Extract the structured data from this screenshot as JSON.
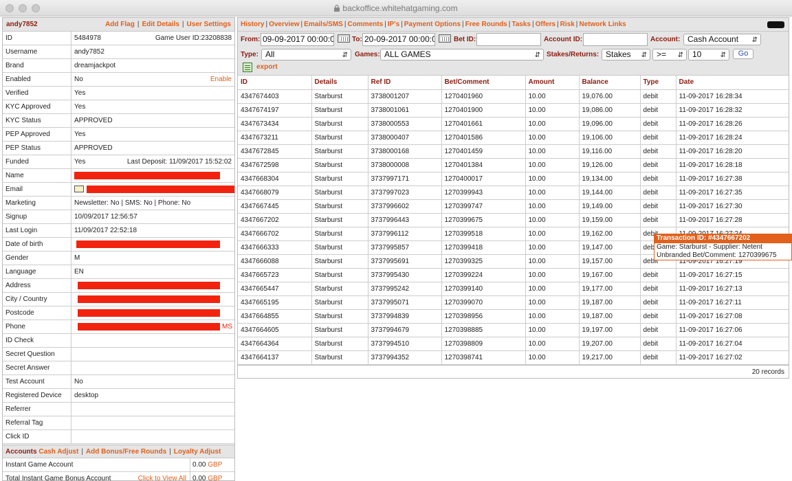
{
  "browser": {
    "url": "backoffice.whitehatgaming.com"
  },
  "player": {
    "username_title": "andy7852",
    "header_links": [
      "Add Flag",
      "Edit Details",
      "User Settings"
    ],
    "rows": [
      {
        "label": "ID",
        "value": "5484978",
        "extra": "Game User ID:23208838"
      },
      {
        "label": "Username",
        "value": "andy7852"
      },
      {
        "label": "Brand",
        "value": "dreamjackpot"
      },
      {
        "label": "Enabled",
        "value": "No",
        "extra_link": "Enable"
      },
      {
        "label": "Verified",
        "value": "Yes"
      },
      {
        "label": "KYC Approved",
        "value": "Yes"
      },
      {
        "label": "KYC Status",
        "value": "APPROVED"
      },
      {
        "label": "PEP Approved",
        "value": "Yes"
      },
      {
        "label": "PEP Status",
        "value": "APPROVED"
      },
      {
        "label": "Funded",
        "value": "Yes",
        "extra": "Last Deposit: 11/09/2017 15:52:02"
      },
      {
        "label": "Name",
        "redacted": true
      },
      {
        "label": "Email",
        "redacted": true,
        "icon": "email-icon"
      },
      {
        "label": "Marketing",
        "value": "Newsletter: No  |  SMS: No  |  Phone: No"
      },
      {
        "label": "Signup",
        "value": "10/09/2017 12:56:57"
      },
      {
        "label": "Last Login",
        "value": "11/09/2017 22:52:18"
      },
      {
        "label": "Date of birth",
        "redacted": true
      },
      {
        "label": "Gender",
        "value": "M"
      },
      {
        "label": "Language",
        "value": "EN"
      },
      {
        "label": "Address",
        "redacted": true
      },
      {
        "label": "City / Country",
        "redacted": true
      },
      {
        "label": "Postcode",
        "redacted": true
      },
      {
        "label": "Phone",
        "redacted": true,
        "suffix": "MS"
      },
      {
        "label": "ID Check",
        "value": ""
      },
      {
        "label": "Secret Question",
        "value": ""
      },
      {
        "label": "Secret Answer",
        "value": ""
      },
      {
        "label": "Test Account",
        "value": "No"
      },
      {
        "label": "Registered Device",
        "value": "desktop"
      },
      {
        "label": "Referrer",
        "value": ""
      },
      {
        "label": "Referral Tag",
        "value": ""
      },
      {
        "label": "Click ID",
        "value": ""
      }
    ],
    "accounts": {
      "title": "Accounts",
      "links": [
        "Cash Adjust",
        "Add Bonus/Free Rounds",
        "Loyalty Adjust"
      ],
      "rows": [
        {
          "label": "Instant Game Account",
          "value": "0.00",
          "currency": "GBP"
        },
        {
          "label": "Total Instant Game Bonus Account",
          "link": "Click to View All",
          "value": "0.00",
          "currency": "GBP"
        }
      ]
    }
  },
  "nav": {
    "tabs": [
      "History",
      "Overview",
      "Emails/SMS",
      "Comments",
      "IP's",
      "Payment Options",
      "Free Rounds",
      "Tasks",
      "Offers",
      "Risk",
      "Network Links"
    ]
  },
  "filters": {
    "from_label": "From:",
    "from_value": "09-09-2017 00:00:00",
    "to_label": "To:",
    "to_value": "20-09-2017 00:00:00",
    "betid_label": "Bet ID:",
    "betid_value": "",
    "accountid_label": "Account ID:",
    "accountid_value": "",
    "account_label": "Account:",
    "account_value": "Cash Account",
    "type_label": "Type:",
    "type_value": "All",
    "games_label": "Games:",
    "games_value": "ALL GAMES",
    "stakes_label": "Stakes/Returns:",
    "stakes_value": "Stakes",
    "op_value": ">=",
    "amount_value": "10",
    "go_label": "Go",
    "export_label": "export"
  },
  "table": {
    "columns": [
      "ID",
      "Details",
      "Ref ID",
      "Bet/Comment",
      "Amount",
      "Balance",
      "Type",
      "Date"
    ],
    "rows": [
      [
        "4347674403",
        "Starburst",
        "3738001207",
        "1270401960",
        "10.00",
        "19,076.00",
        "debit",
        "11-09-2017 16:28:34"
      ],
      [
        "4347674197",
        "Starburst",
        "3738001061",
        "1270401900",
        "10.00",
        "19,086.00",
        "debit",
        "11-09-2017 16:28:32"
      ],
      [
        "4347673434",
        "Starburst",
        "3738000553",
        "1270401661",
        "10.00",
        "19,096.00",
        "debit",
        "11-09-2017 16:28:26"
      ],
      [
        "4347673211",
        "Starburst",
        "3738000407",
        "1270401586",
        "10.00",
        "19,106.00",
        "debit",
        "11-09-2017 16:28:24"
      ],
      [
        "4347672845",
        "Starburst",
        "3738000168",
        "1270401459",
        "10.00",
        "19,116.00",
        "debit",
        "11-09-2017 16:28:20"
      ],
      [
        "4347672598",
        "Starburst",
        "3738000008",
        "1270401384",
        "10.00",
        "19,126.00",
        "debit",
        "11-09-2017 16:28:18"
      ],
      [
        "4347668304",
        "Starburst",
        "3737997171",
        "1270400017",
        "10.00",
        "19,134.00",
        "debit",
        "11-09-2017 16:27:38"
      ],
      [
        "4347668079",
        "Starburst",
        "3737997023",
        "1270399943",
        "10.00",
        "19,144.00",
        "debit",
        "11-09-2017 16:27:35"
      ],
      [
        "4347667445",
        "Starburst",
        "3737996602",
        "1270399747",
        "10.00",
        "19,149.00",
        "debit",
        "11-09-2017 16:27:30"
      ],
      [
        "4347667202",
        "Starburst",
        "3737996443",
        "1270399675",
        "10.00",
        "19,159.00",
        "debit",
        "11-09-2017 16:27:28"
      ],
      [
        "4347666702",
        "Starburst",
        "3737996112",
        "1270399518",
        "10.00",
        "19,162.00",
        "debit",
        "11-09-2017 16:27:24"
      ],
      [
        "4347666333",
        "Starburst",
        "3737995857",
        "1270399418",
        "10.00",
        "19,147.00",
        "debit",
        "11-09-2017 16:27:21"
      ],
      [
        "4347666088",
        "Starburst",
        "3737995691",
        "1270399325",
        "10.00",
        "19,157.00",
        "debit",
        "11-09-2017 16:27:19"
      ],
      [
        "4347665723",
        "Starburst",
        "3737995430",
        "1270399224",
        "10.00",
        "19,167.00",
        "debit",
        "11-09-2017 16:27:15"
      ],
      [
        "4347665447",
        "Starburst",
        "3737995242",
        "1270399140",
        "10.00",
        "19,177.00",
        "debit",
        "11-09-2017 16:27:13"
      ],
      [
        "4347665195",
        "Starburst",
        "3737995071",
        "1270399070",
        "10.00",
        "19,187.00",
        "debit",
        "11-09-2017 16:27:11"
      ],
      [
        "4347664855",
        "Starburst",
        "3737994839",
        "1270398956",
        "10.00",
        "19,187.00",
        "debit",
        "11-09-2017 16:27:08"
      ],
      [
        "4347664605",
        "Starburst",
        "3737994679",
        "1270398885",
        "10.00",
        "19,197.00",
        "debit",
        "11-09-2017 16:27:06"
      ],
      [
        "4347664364",
        "Starburst",
        "3737994510",
        "1270398809",
        "10.00",
        "19,207.00",
        "debit",
        "11-09-2017 16:27:04"
      ],
      [
        "4347664137",
        "Starburst",
        "3737994352",
        "1270398741",
        "10.00",
        "19,217.00",
        "debit",
        "11-09-2017 16:27:02"
      ]
    ],
    "records_label": "20 records"
  },
  "tooltip": {
    "title": "Transaction ID: #4347667202",
    "line1": "Game: Starburst - Supplier: Netent",
    "line2": "Unbranded Bet/Comment: 1270399675"
  },
  "colors": {
    "accent": "#e0601c",
    "label": "#8b1c10",
    "redaction": "#f2230e"
  }
}
